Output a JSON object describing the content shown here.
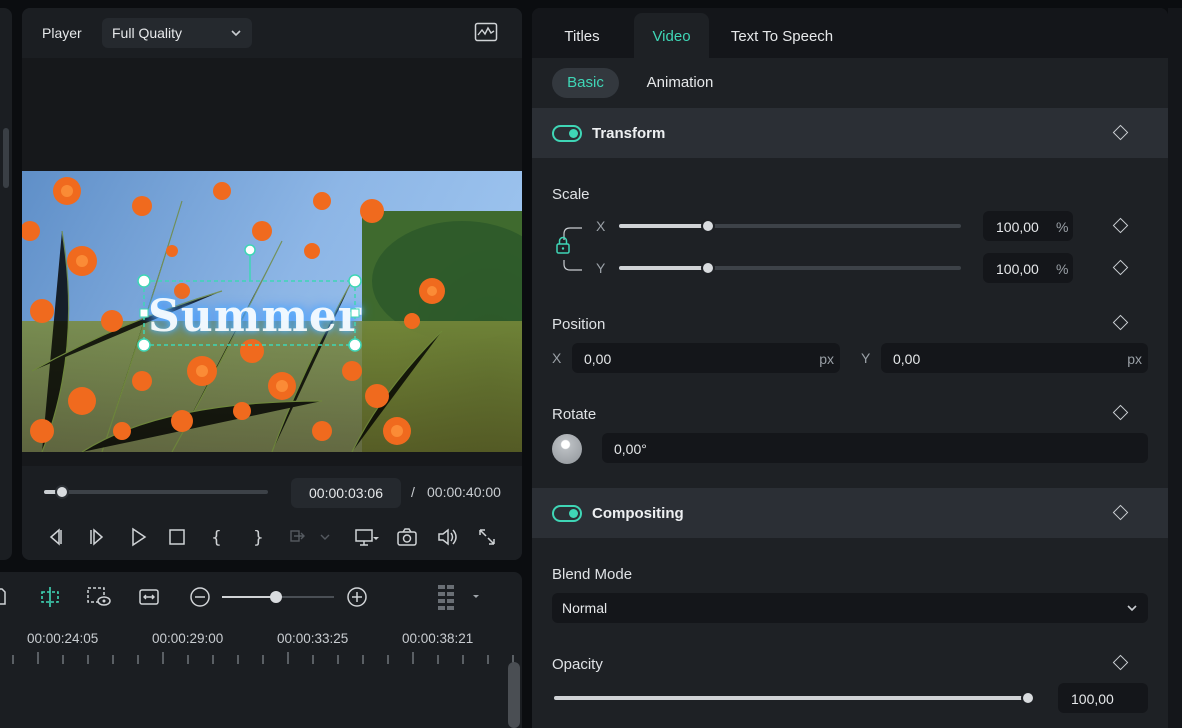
{
  "player": {
    "label": "Player",
    "quality": "Full Quality",
    "current_time": "00:00:03:06",
    "separator": "/",
    "total_time": "00:00:40:00",
    "progress": 0.08,
    "overlay_text": "Summer"
  },
  "timeline": {
    "ticks": [
      "00:00:24:05",
      "00:00:29:00",
      "00:00:33:25",
      "00:00:38:21"
    ],
    "zoom_level": 0.48
  },
  "panel": {
    "tabs": [
      "Titles",
      "Video",
      "Text To Speech"
    ],
    "active_tab": "Video",
    "subtabs": [
      "Basic",
      "Animation"
    ],
    "active_subtab": "Basic",
    "transform": {
      "title": "Transform",
      "enabled": true,
      "scale": {
        "label": "Scale",
        "x_axis": "X",
        "y_axis": "Y",
        "x_value": "100,00",
        "y_value": "100,00",
        "unit": "%",
        "x_level": 0.26,
        "y_level": 0.26
      },
      "position": {
        "label": "Position",
        "x_axis": "X",
        "y_axis": "Y",
        "x_value": "0,00",
        "y_value": "0,00",
        "unit": "px"
      },
      "rotate": {
        "label": "Rotate",
        "value": "0,00°"
      }
    },
    "compositing": {
      "title": "Compositing",
      "enabled": true,
      "blend_label": "Blend Mode",
      "blend_value": "Normal",
      "opacity_label": "Opacity",
      "opacity_value": "100,00",
      "opacity_level": 1.0
    }
  },
  "colors": {
    "accent": "#3fd6b6",
    "panel": "#1e2125",
    "background": "#0b0d10"
  }
}
